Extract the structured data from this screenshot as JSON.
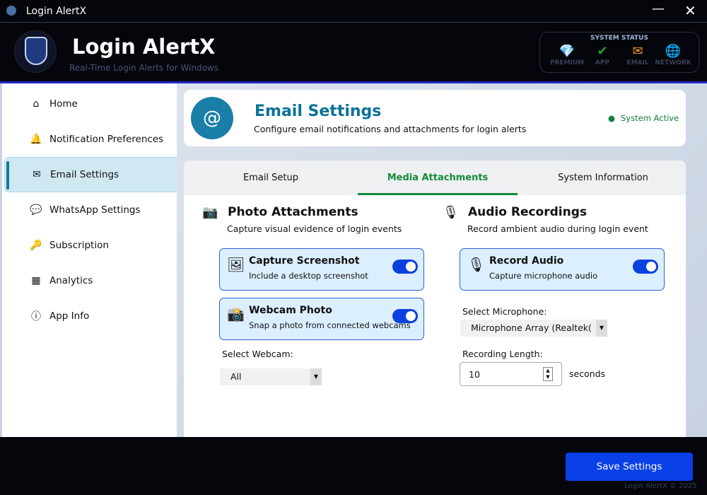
{
  "window": {
    "title": "Login AlertX",
    "minimize": "—",
    "close": "✕"
  },
  "header": {
    "title": "Login AlertX",
    "subtitle": "Real-Time Login Alerts for Windows"
  },
  "system_status": {
    "label": "SYSTEM STATUS",
    "items": [
      {
        "label": "PREMIUM",
        "icon": "💎"
      },
      {
        "label": "APP",
        "icon": "✔"
      },
      {
        "label": "EMAIL",
        "icon": "✉"
      },
      {
        "label": "NETWORK",
        "icon": "🌐"
      }
    ]
  },
  "sidebar": {
    "items": [
      {
        "label": "Home",
        "icon": "⌂"
      },
      {
        "label": "Notification Preferences",
        "icon": "🔔"
      },
      {
        "label": "Email Settings",
        "icon": "✉"
      },
      {
        "label": "WhatsApp Settings",
        "icon": "💬"
      },
      {
        "label": "Subscription",
        "icon": "🔑"
      },
      {
        "label": "Analytics",
        "icon": "▦"
      },
      {
        "label": "App Info",
        "icon": "ⓘ"
      }
    ]
  },
  "page": {
    "icon": "@",
    "title": "Email Settings",
    "subtitle": "Configure email notifications and attachments for login alerts",
    "status": "System Active"
  },
  "tabs": [
    {
      "label": "Email Setup"
    },
    {
      "label": "Media Attachments"
    },
    {
      "label": "System Information"
    }
  ],
  "photo": {
    "icon": "📷",
    "title": "Photo Attachments",
    "subtitle": "Capture visual evidence of login events",
    "options": [
      {
        "title": "Capture Screenshot",
        "desc": "Include a desktop screenshot",
        "enabled": true,
        "icon": "🖼"
      },
      {
        "title": "Webcam Photo",
        "desc": "Snap a photo from connected webcams",
        "enabled": true,
        "icon": "📸"
      }
    ],
    "webcam_label": "Select Webcam:",
    "webcam_value": "All"
  },
  "audio": {
    "icon": "🎙",
    "title": "Audio Recordings",
    "subtitle": "Record ambient audio during login event",
    "option": {
      "title": "Record Audio",
      "desc": "Capture microphone audio",
      "enabled": true,
      "icon": "🎙"
    },
    "mic_label": "Select Microphone:",
    "mic_value": "Microphone Array (Realtek(",
    "length_label": "Recording Length:",
    "length_value": "10",
    "length_unit": "seconds"
  },
  "footer": {
    "save": "Save Settings",
    "copyright": "Login AlertX © 2025"
  }
}
